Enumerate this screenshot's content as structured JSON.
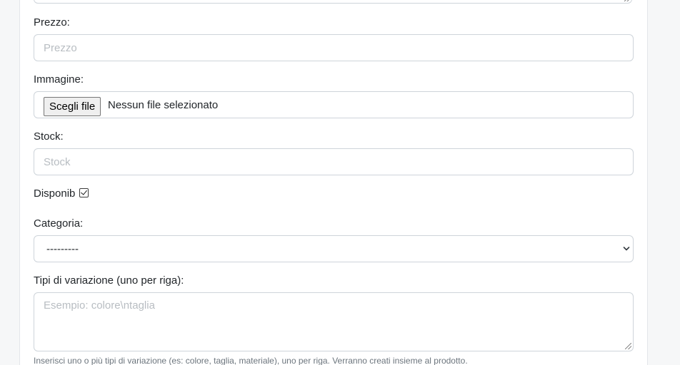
{
  "form": {
    "price": {
      "label": "Prezzo:",
      "placeholder": "Prezzo"
    },
    "image": {
      "label": "Immagine:",
      "button_label": "Scegli file",
      "status": "Nessun file selezionato"
    },
    "stock": {
      "label": "Stock:",
      "placeholder": "Stock"
    },
    "available": {
      "label_prefix": "Disponib",
      "label_suffix": ":",
      "checked": true
    },
    "category": {
      "label": "Categoria:",
      "selected": "---------"
    },
    "variation_types": {
      "label": "Tipi di variazione (uno per riga):",
      "placeholder": "Esempio: colore\\ntaglia",
      "help": "Inserisci uno o più tipi di variazione (es: colore, taglia, materiale), uno per riga. Verranno creati insieme al prodotto."
    }
  }
}
